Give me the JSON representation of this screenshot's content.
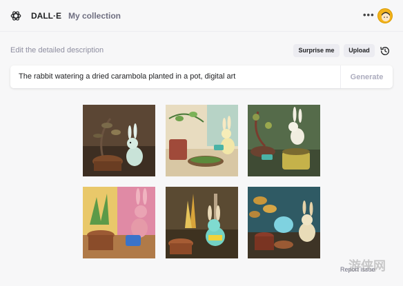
{
  "header": {
    "brand": "DALL·E",
    "collection_link": "My collection",
    "logo_icon": "openai-logo-icon",
    "menu_icon": "more-dots-icon"
  },
  "prompt": {
    "label": "Edit the detailed description",
    "surprise_label": "Surprise me",
    "upload_label": "Upload",
    "history_icon": "history-icon",
    "value": "The rabbit watering a dried carambola planted in a pot, digital art",
    "generate_label": "Generate"
  },
  "results": {
    "images": [
      {
        "alt": "rabbit tending a potted sapling"
      },
      {
        "alt": "rabbit watering a pot of seedlings"
      },
      {
        "alt": "rabbit watering a green pot"
      },
      {
        "alt": "pink rabbit with watering can"
      },
      {
        "alt": "blue rabbit with potted plant"
      },
      {
        "alt": "rabbit watering a crystal plant"
      }
    ]
  },
  "footer": {
    "report_issue": "Report issue",
    "watermark": "游侠网"
  },
  "colors": {
    "background": "#f7f7f8",
    "avatar": "#f2b21a",
    "muted_text": "#8e8ea0"
  }
}
